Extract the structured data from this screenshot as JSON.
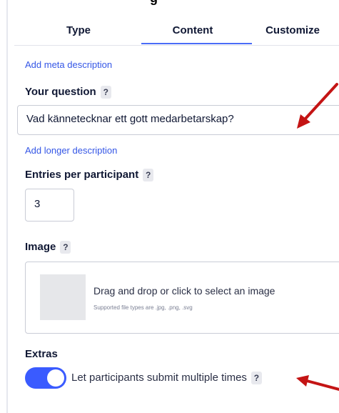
{
  "header": {
    "title_fragment": "g"
  },
  "tabs": [
    {
      "label": "Type",
      "active": false
    },
    {
      "label": "Content",
      "active": true
    },
    {
      "label": "Customize",
      "active": false
    }
  ],
  "meta_link": "Add meta description",
  "question": {
    "label": "Your question",
    "help": "?",
    "value": "Vad kännetecknar ett gott medarbetarskap?",
    "longer_link": "Add longer description"
  },
  "entries": {
    "label": "Entries per participant",
    "help": "?",
    "value": "3"
  },
  "image": {
    "label": "Image",
    "help": "?",
    "drop_text": "Drag and drop or click to select an image",
    "supported": "Supported file types are .jpg, .png, .svg"
  },
  "extras": {
    "label": "Extras",
    "toggle_on": true,
    "toggle_label": "Let participants submit multiple times",
    "help": "?"
  },
  "colors": {
    "accent": "#3a5bff",
    "link": "#3456e6",
    "annotation_arrow": "#c41414"
  }
}
